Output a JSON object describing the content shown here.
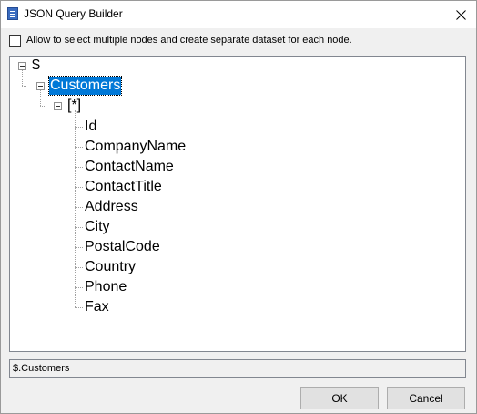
{
  "window": {
    "title": "JSON Query Builder"
  },
  "options": {
    "multi_select_label": "Allow to select multiple nodes and create separate dataset for each node.",
    "multi_select_checked": false
  },
  "tree": {
    "root": "$",
    "customers": "Customers",
    "array": "[*]",
    "fields": [
      "Id",
      "CompanyName",
      "ContactName",
      "ContactTitle",
      "Address",
      "City",
      "PostalCode",
      "Country",
      "Phone",
      "Fax"
    ],
    "selected": "Customers"
  },
  "path": {
    "value": "$.Customers"
  },
  "buttons": {
    "ok": "OK",
    "cancel": "Cancel"
  },
  "icons": {
    "app": "json-app-icon",
    "close": "close-icon",
    "expander": "minus-box-icon"
  },
  "colors": {
    "selection": "#0078d7"
  }
}
